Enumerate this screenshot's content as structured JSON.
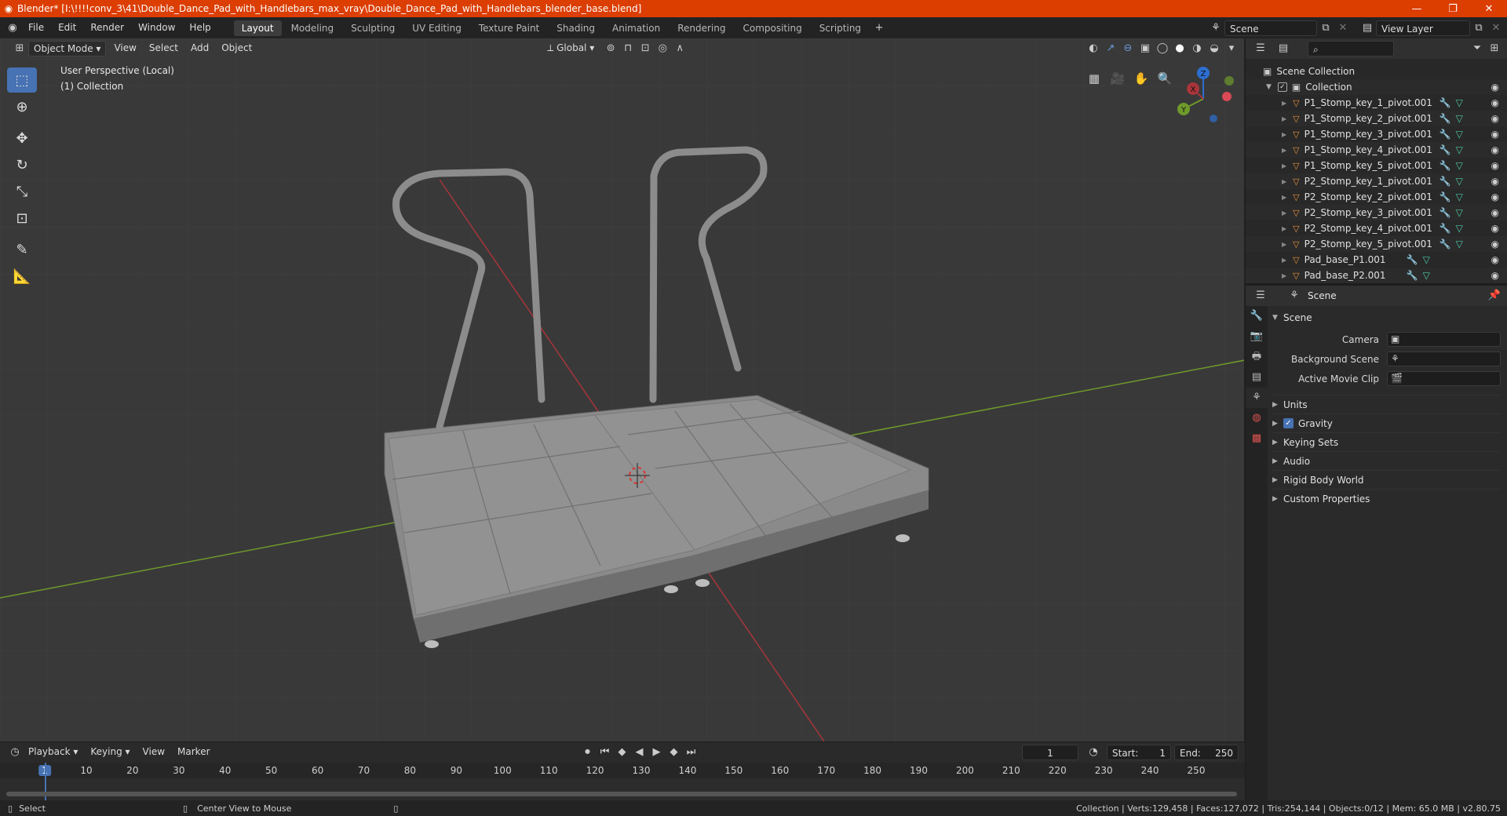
{
  "window": {
    "title": "Blender* [I:\\!!!!conv_3\\41\\Double_Dance_Pad_with_Handlebars_max_vray\\Double_Dance_Pad_with_Handlebars_blender_base.blend]",
    "controls": [
      "—",
      "❐",
      "✕"
    ]
  },
  "menus": [
    "File",
    "Edit",
    "Render",
    "Window",
    "Help"
  ],
  "workspaces": [
    {
      "label": "Layout",
      "active": true
    },
    {
      "label": "Modeling"
    },
    {
      "label": "Sculpting"
    },
    {
      "label": "UV Editing"
    },
    {
      "label": "Texture Paint"
    },
    {
      "label": "Shading"
    },
    {
      "label": "Animation"
    },
    {
      "label": "Rendering"
    },
    {
      "label": "Compositing"
    },
    {
      "label": "Scripting"
    }
  ],
  "scene_field": "Scene",
  "view_layer_field": "View Layer",
  "viewport": {
    "mode": "Object Mode",
    "menus": [
      "View",
      "Select",
      "Add",
      "Object"
    ],
    "transform_orientation": "Global",
    "overlay_line1": "User Perspective (Local)",
    "overlay_line2": "(1) Collection",
    "gizmo_axes": {
      "x": "X",
      "y": "Y",
      "z": "Z"
    }
  },
  "timeline": {
    "menus": [
      "Playback",
      "Keying",
      "View",
      "Marker"
    ],
    "current_frame": "1",
    "start_label": "Start:",
    "start": "1",
    "end_label": "End:",
    "end": "250",
    "ticks": [
      "1",
      "10",
      "20",
      "30",
      "40",
      "50",
      "60",
      "70",
      "80",
      "90",
      "100",
      "110",
      "120",
      "130",
      "140",
      "150",
      "160",
      "170",
      "180",
      "190",
      "200",
      "210",
      "220",
      "230",
      "240",
      "250"
    ]
  },
  "statusbar": {
    "left1": "Select",
    "left2": "Center View to Mouse",
    "right": "Collection | Verts:129,458 | Faces:127,072 | Tris:254,144 | Objects:0/12 | Mem: 65.0 MB | v2.80.75"
  },
  "outliner": {
    "root": "Scene Collection",
    "collection": "Collection",
    "objects": [
      "P1_Stomp_key_1_pivot.001",
      "P1_Stomp_key_2_pivot.001",
      "P1_Stomp_key_3_pivot.001",
      "P1_Stomp_key_4_pivot.001",
      "P1_Stomp_key_5_pivot.001",
      "P2_Stomp_key_1_pivot.001",
      "P2_Stomp_key_2_pivot.001",
      "P2_Stomp_key_3_pivot.001",
      "P2_Stomp_key_4_pivot.001",
      "P2_Stomp_key_5_pivot.001",
      "Pad_base_P1.001",
      "Pad_base_P2.001"
    ]
  },
  "properties": {
    "context": "Scene",
    "panel": "Scene",
    "fields": [
      {
        "label": "Camera",
        "value": ""
      },
      {
        "label": "Background Scene",
        "value": ""
      },
      {
        "label": "Active Movie Clip",
        "value": ""
      }
    ],
    "subpanels": [
      "Units",
      "Gravity",
      "Keying Sets",
      "Audio",
      "Rigid Body World",
      "Custom Properties"
    ]
  },
  "colors": {
    "accent": "#4772b3",
    "title_bar": "#dc3e00",
    "viewport_bg": "#393939",
    "x_axis": "#a8353a",
    "y_axis": "#6e9a2b",
    "z_axis": "#2c6fd0"
  }
}
